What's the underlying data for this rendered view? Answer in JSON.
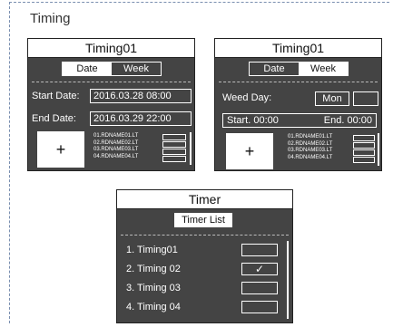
{
  "section_title": "Timing",
  "panel1": {
    "title": "Timing01",
    "tabs": [
      "Date",
      "Week"
    ],
    "start_label": "Start Date:",
    "start_value": "2016.03.28   08:00",
    "end_label": "End Date:",
    "end_value": "2016.03.29   22:00",
    "plus": "+",
    "names": [
      "01.RDNAME01.LT",
      "02.RDNAME02.LT",
      "03.RDNAME03.LT",
      "04.RDNAME04.LT"
    ]
  },
  "panel2": {
    "title": "Timing01",
    "tabs": [
      "Date",
      "Week"
    ],
    "weed_label": "Weed Day:",
    "weed_value": "Mon",
    "start_label": "Start. 00:00",
    "end_label": "End. 00:00",
    "plus": "+",
    "names": [
      "01.RDNAME01.LT",
      "02.RDNAME02.LT",
      "03.RDNAME03.LT",
      "04.RDNAME04.LT"
    ]
  },
  "timer": {
    "title": "Timer",
    "list_button": "Timer List",
    "items": [
      {
        "label": "1. Timing01",
        "checked": false
      },
      {
        "label": "2. Timing 02",
        "checked": true
      },
      {
        "label": "3. Timing 03",
        "checked": false
      },
      {
        "label": "4. Timing 04",
        "checked": false
      }
    ],
    "check_glyph": "✓"
  }
}
